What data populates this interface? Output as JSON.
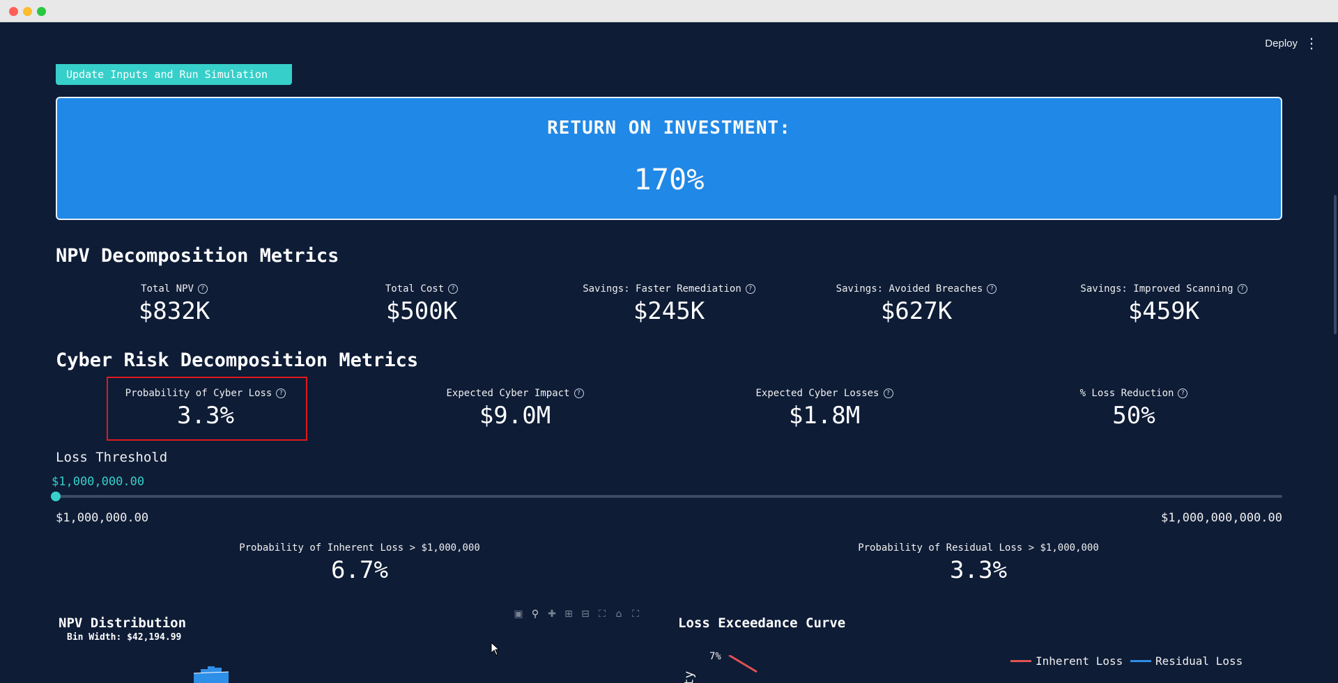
{
  "header": {
    "deploy_label": "Deploy",
    "menu_icon": "vertical-dots-icon"
  },
  "actions": {
    "run_label": "Update Inputs and Run Simulation"
  },
  "roi": {
    "title": "RETURN ON INVESTMENT:",
    "value": "170%"
  },
  "npv_section": {
    "title": "NPV Decomposition Metrics",
    "metrics": [
      {
        "label": "Total NPV",
        "value": "$832K"
      },
      {
        "label": "Total Cost",
        "value": "$500K"
      },
      {
        "label": "Savings: Faster Remediation",
        "value": "$245K"
      },
      {
        "label": "Savings: Avoided Breaches",
        "value": "$627K"
      },
      {
        "label": "Savings: Improved Scanning",
        "value": "$459K"
      }
    ]
  },
  "risk_section": {
    "title": "Cyber Risk Decomposition Metrics",
    "metrics": [
      {
        "label": "Probability of Cyber Loss",
        "value": "3.3%"
      },
      {
        "label": "Expected Cyber Impact",
        "value": "$9.0M"
      },
      {
        "label": "Expected Cyber Losses",
        "value": "$1.8M"
      },
      {
        "label": "% Loss Reduction",
        "value": "50%"
      }
    ]
  },
  "slider": {
    "label": "Loss Threshold",
    "current": "$1,000,000.00",
    "min": "$1,000,000.00",
    "max": "$1,000,000,000.00",
    "level_fraction": 0
  },
  "threshold_metrics": [
    {
      "label": "Probability of Inherent Loss > $1,000,000",
      "value": "6.7%"
    },
    {
      "label": "Probability of Residual Loss > $1,000,000",
      "value": "3.3%"
    }
  ],
  "npv_chart": {
    "title": "NPV Distribution",
    "subtitle": "Bin Width: $42,194.99"
  },
  "loss_chart": {
    "title": "Loss Exceedance Curve",
    "y_tick_top": "7%",
    "y_label_partial": "ty",
    "legend": [
      {
        "name": "Inherent Loss",
        "color": "#e05252"
      },
      {
        "name": "Residual Loss",
        "color": "#2e8fe8"
      }
    ]
  },
  "colors": {
    "accent": "#36cfc9",
    "roi_bg": "#2088e6",
    "page_bg": "#0e1c36",
    "highlight": "#e0191c"
  }
}
